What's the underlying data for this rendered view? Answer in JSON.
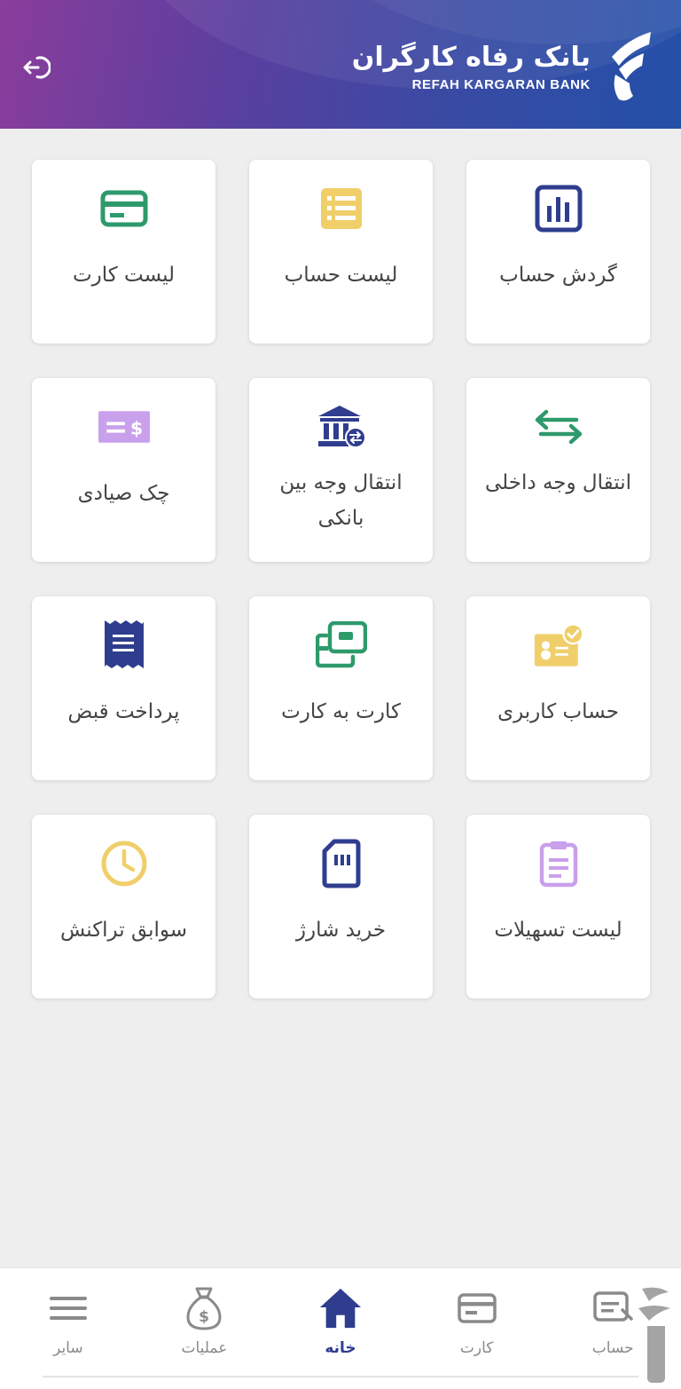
{
  "header": {
    "brand_name_fa": "بانک رفاه کارگران",
    "brand_name_en": "REFAH KARGARAN BANK",
    "logout_icon": "logout-icon"
  },
  "tiles": [
    {
      "label": "گردش حساب",
      "icon": "bar-chart-icon",
      "color": "#2f3d8f"
    },
    {
      "label": "لیست حساب",
      "icon": "list-icon",
      "color": "#f0cf6a"
    },
    {
      "label": "لیست کارت",
      "icon": "credit-card-icon",
      "color": "#2e9a6c"
    },
    {
      "label": "انتقال وجه داخلی",
      "icon": "transfer-arrows-icon",
      "color": "#2e9a6c"
    },
    {
      "label": "انتقال وجه بین بانکی",
      "icon": "bank-icon",
      "color": "#2f3d8f"
    },
    {
      "label": "چک صیادی",
      "icon": "cheque-icon",
      "color": "#c9a0ec"
    },
    {
      "label": "حساب کاربری",
      "icon": "user-id-icon",
      "color": "#f0cf6a"
    },
    {
      "label": "کارت به کارت",
      "icon": "card-to-card-icon",
      "color": "#2e9a6c"
    },
    {
      "label": "پرداخت قبض",
      "icon": "receipt-icon",
      "color": "#2f3d8f"
    },
    {
      "label": "لیست تسهیلات",
      "icon": "clipboard-icon",
      "color": "#c9a0ec"
    },
    {
      "label": "خرید شارژ",
      "icon": "sim-card-icon",
      "color": "#2f3d8f"
    },
    {
      "label": "سوابق تراکنش",
      "icon": "clock-icon",
      "color": "#f0cf6a"
    }
  ],
  "bottom_nav": [
    {
      "label": "حساب",
      "icon": "account-icon",
      "active": false
    },
    {
      "label": "کارت",
      "icon": "card-icon",
      "active": false
    },
    {
      "label": "خانه",
      "icon": "home-icon",
      "active": true
    },
    {
      "label": "عملیات",
      "icon": "money-bag-icon",
      "active": false
    },
    {
      "label": "سایر",
      "icon": "menu-icon",
      "active": false
    }
  ],
  "colors": {
    "primary": "#2f3d8f",
    "green": "#2e9a6c",
    "yellow": "#f0cf6a",
    "purple": "#c9a0ec",
    "inactive": "#8a8a8a"
  }
}
